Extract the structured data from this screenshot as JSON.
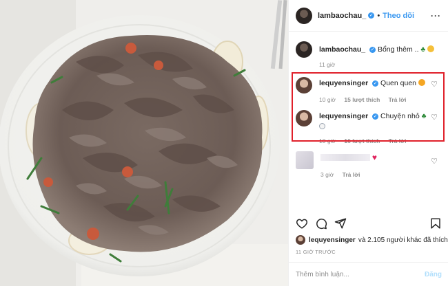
{
  "post": {
    "username": "lambaochau_",
    "follow_label": "Theo dõi",
    "more_icon": "more-horizontal-icon"
  },
  "caption": {
    "username": "lambaochau_",
    "text": "Bổng thêm ..",
    "time": "11 giờ"
  },
  "comments": [
    {
      "username": "lequyensinger",
      "text": "Quen quen",
      "time": "10 giờ",
      "likes": "15 lượt thích",
      "reply": "Trả lời"
    },
    {
      "username": "lequyensinger",
      "text": "Chuyện nhỏ",
      "time": "10 giờ",
      "likes": "16 lượt thích",
      "reply": "Trả lời"
    },
    {
      "username": "",
      "text": "",
      "time": "3 giờ",
      "reply": "Trả lời"
    }
  ],
  "actions": {
    "icons": [
      "heart-icon",
      "comment-icon",
      "share-icon",
      "bookmark-icon"
    ]
  },
  "likes": {
    "user": "lequyensinger",
    "rest": "và 2.105 người khác đã thích"
  },
  "timestamp": "11 GIỜ TRƯỚC",
  "add_comment": {
    "placeholder": "Thêm bình luận...",
    "post_label": "Đăng"
  },
  "colors": {
    "accent": "#3897f0",
    "highlight": "#e0202a",
    "muted": "#8e8e8e"
  }
}
